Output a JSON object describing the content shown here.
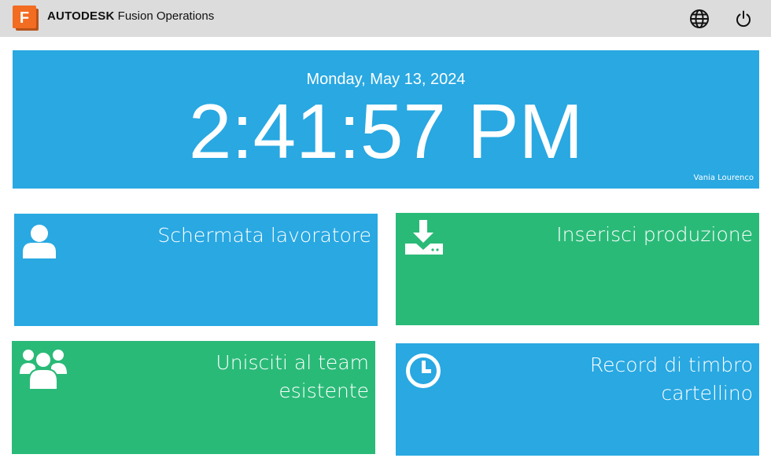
{
  "header": {
    "brand_bold": "AUTODESK",
    "brand_product": "Fusion Operations",
    "logo_letter": "F",
    "icons": {
      "language": "globe-icon",
      "power": "power-icon"
    }
  },
  "clock": {
    "date": "Monday, May 13, 2024",
    "time": "2:41:57 PM",
    "user": "Vania Lourenco"
  },
  "tiles": [
    {
      "label_lines": [
        "Schermata lavoratore"
      ],
      "icon": "user-icon",
      "color": "#29a8e2"
    },
    {
      "label_lines": [
        "Inserisci produzione"
      ],
      "icon": "download-tray-icon",
      "color": "#2aba78"
    },
    {
      "label_lines": [
        "Unisciti al team",
        "esistente"
      ],
      "icon": "team-icon",
      "color": "#2aba78"
    },
    {
      "label_lines": [
        "Record di timbro",
        "cartellino"
      ],
      "icon": "clock-icon",
      "color": "#29a8e2"
    }
  ],
  "colors": {
    "accent_blue": "#29a8e2",
    "accent_green": "#2aba78",
    "topbar": "#dcdcdc",
    "logo_orange": "#f26c22"
  }
}
